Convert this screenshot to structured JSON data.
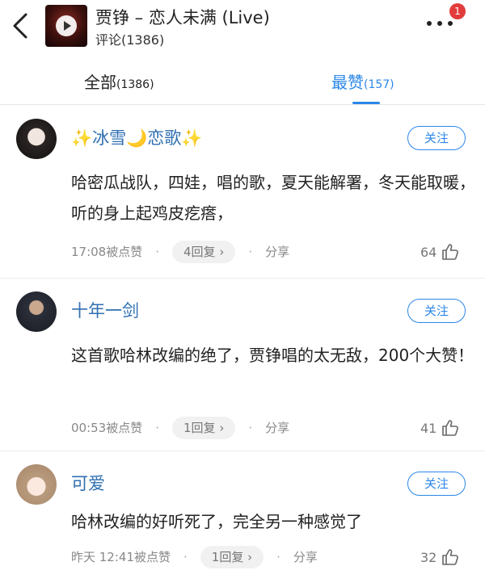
{
  "header": {
    "song_title": "贾铮 – 恋人未满 (Live)",
    "comment_count": "评论(1386)",
    "notification_badge": "1"
  },
  "tabs": [
    {
      "label": "全部",
      "count": "(1386)"
    },
    {
      "label": "最赞",
      "count": "(157)"
    }
  ],
  "comments": [
    {
      "username": "✨冰雪🌙恋歌✨",
      "follow_label": "关注",
      "text": "哈密瓜战队，四娃，唱的歌，夏天能解署，冬天能取暖，听的身上起鸡皮疙瘩，",
      "time": "17:08被点赞",
      "replies": "4回复",
      "share": "分享",
      "likes": "64"
    },
    {
      "username": "十年一剑",
      "follow_label": "关注",
      "text": "这首歌哈林改编的绝了，贾铮唱的太无敌，200个大赞！",
      "time": "00:53被点赞",
      "replies": "1回复",
      "share": "分享",
      "likes": "41"
    },
    {
      "username": "可爱",
      "follow_label": "关注",
      "text": "哈林改编的好听死了，完全另一种感觉了",
      "time": "昨天 12:41被点赞",
      "replies": "1回复",
      "share": "分享",
      "likes": "32"
    }
  ],
  "colors": {
    "accent": "#2b87e8",
    "username": "#2f6fb1",
    "badge": "#e23c3c"
  }
}
